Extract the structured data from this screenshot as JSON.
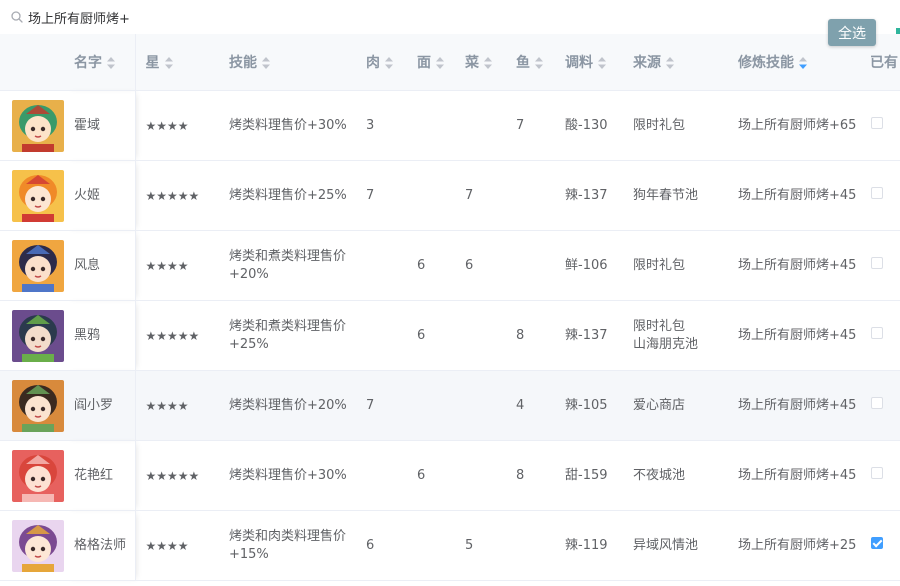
{
  "search": {
    "value": "场上所有厨师烤+"
  },
  "toolbar": {
    "select_all": "全选"
  },
  "columns": [
    {
      "label": "名字",
      "sort": "none"
    },
    {
      "label": "星",
      "sort": "none"
    },
    {
      "label": "技能",
      "sort": "none"
    },
    {
      "label": "肉",
      "sort": "none"
    },
    {
      "label": "面",
      "sort": "none"
    },
    {
      "label": "菜",
      "sort": "none"
    },
    {
      "label": "鱼",
      "sort": "none"
    },
    {
      "label": "调料",
      "sort": "none"
    },
    {
      "label": "来源",
      "sort": "none"
    },
    {
      "label": "修炼技能",
      "sort": "desc"
    },
    {
      "label": "已有",
      "sort": "none"
    }
  ],
  "colors": {
    "sort_idle": "#c0c4cc",
    "sort_active": "#409eff",
    "accent_button": "#7fa1ad",
    "accent_strip": "#2fb59c"
  },
  "rows": [
    {
      "name": "霍域",
      "stars": "★★★★",
      "skill": "烤类料理售价+30%",
      "meat": "3",
      "flour": "",
      "veg": "",
      "fish": "7",
      "condiment": "酸-130",
      "source": "限时礼包",
      "source2": "",
      "ult": "场上所有厨师烤+65",
      "owned": false,
      "clip": "",
      "avatar": "green"
    },
    {
      "name": "火姬",
      "stars": "★★★★★",
      "skill": "烤类料理售价+25%",
      "meat": "7",
      "flour": "",
      "veg": "7",
      "fish": "",
      "condiment": "辣-137",
      "source": "狗年春节池",
      "source2": "",
      "ult": "场上所有厨师烤+45",
      "owned": false,
      "clip": "",
      "avatar": "red"
    },
    {
      "name": "风息",
      "stars": "★★★★",
      "skill": "烤类和煮类料理售价+20%",
      "meat": "",
      "flour": "6",
      "veg": "6",
      "fish": "",
      "condiment": "鲜-106",
      "source": "限时礼包",
      "source2": "",
      "ult": "场上所有厨师烤+45",
      "owned": false,
      "clip": "",
      "avatar": "dark"
    },
    {
      "name": "黑鸦",
      "stars": "★★★★★",
      "skill": "烤类和煮类料理售价+25%",
      "meat": "",
      "flour": "6",
      "veg": "",
      "fish": "8",
      "condiment": "辣-137",
      "source": "限时礼包",
      "source2": "山海朋克池",
      "ult": "场上所有厨师烤+45",
      "owned": false,
      "clip": "",
      "avatar": "purple"
    },
    {
      "name": "阎小罗",
      "stars": "★★★★",
      "skill": "烤类料理售价+20%",
      "meat": "7",
      "flour": "",
      "veg": "",
      "fish": "4",
      "condiment": "辣-105",
      "source": "爱心商店",
      "source2": "",
      "ult": "场上所有厨师烤+45",
      "owned": false,
      "clip": "",
      "avatar": "brown"
    },
    {
      "name": "花艳红",
      "stars": "★★★★★",
      "skill": "烤类料理售价+30%",
      "meat": "",
      "flour": "6",
      "veg": "",
      "fish": "8",
      "condiment": "甜-159",
      "source": "不夜城池",
      "source2": "",
      "ult": "场上所有厨师烤+45",
      "owned": false,
      "clip": "",
      "avatar": "pink"
    },
    {
      "name": "格格法师",
      "stars": "★★★★",
      "skill": "烤类和肉类料理售价+15%",
      "meat": "6",
      "flour": "",
      "veg": "5",
      "fish": "",
      "condiment": "辣-119",
      "source": "异域风情池",
      "source2": "",
      "ult": "场上所有厨师烤+25",
      "owned": true,
      "clip": "",
      "avatar": "hat"
    }
  ]
}
